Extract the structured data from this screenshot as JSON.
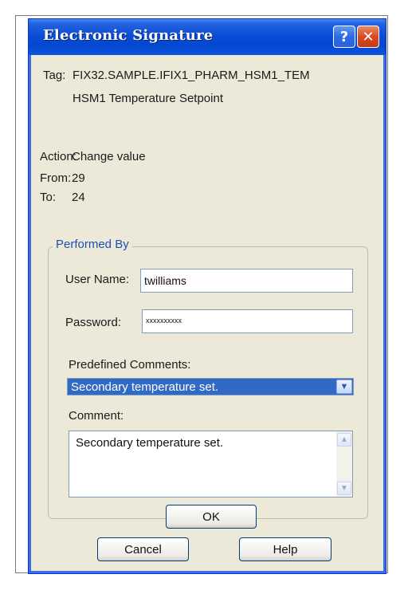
{
  "dialog": {
    "title": "Electronic Signature",
    "help_glyph": "?",
    "close_glyph": "✕"
  },
  "tag": {
    "label": "Tag:",
    "value": "FIX32.SAMPLE.IFIX1_PHARM_HSM1_TEM",
    "description": "HSM1 Temperature Setpoint"
  },
  "action": {
    "action_label": "Action:",
    "action_value": "Change value",
    "from_label": "From:",
    "from_value": "29",
    "to_label": "To:",
    "to_value": "24"
  },
  "performed_by": {
    "legend": "Performed By",
    "user_name_label": "User Name:",
    "user_name_value": "twilliams",
    "password_label": "Password:",
    "password_value": "xxxxxxxxxx",
    "predefined_label": "Predefined Comments:",
    "predefined_value": "Secondary temperature set.",
    "comment_label": "Comment:",
    "comment_value": "Secondary temperature set.",
    "ok_label": "OK"
  },
  "footer": {
    "cancel_label": "Cancel",
    "help_label": "Help"
  }
}
